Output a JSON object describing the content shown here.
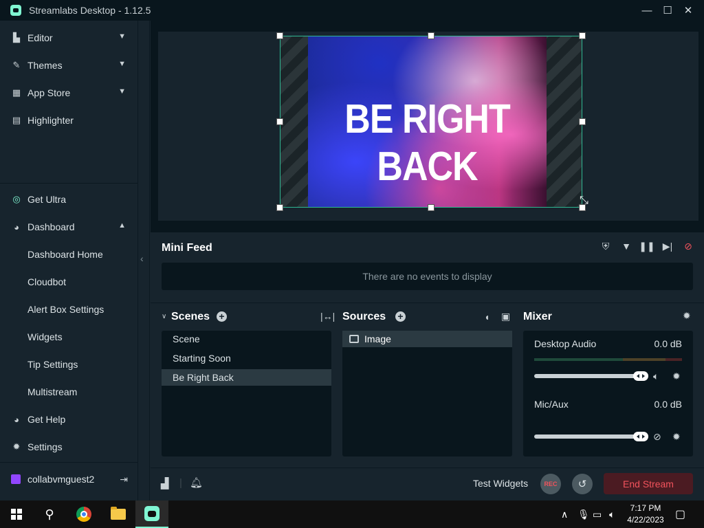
{
  "window": {
    "title": "Streamlabs Desktop - 1.12.5",
    "minimize_icon": "minimize-icon",
    "maximize_icon": "maximize-icon",
    "close_icon": "close-icon"
  },
  "sidebar": {
    "top_items": [
      {
        "label": "Editor",
        "icon": "editor-icon",
        "expandable": true
      },
      {
        "label": "Themes",
        "icon": "themes-icon",
        "expandable": true
      },
      {
        "label": "App Store",
        "icon": "store-icon",
        "expandable": true
      },
      {
        "label": "Highlighter",
        "icon": "clapper-icon",
        "expandable": false
      }
    ],
    "get_ultra": "Get Ultra",
    "dashboard": {
      "label": "Dashboard",
      "expanded": true,
      "sub_items": [
        "Dashboard Home",
        "Cloudbot",
        "Alert Box Settings",
        "Widgets",
        "Tip Settings",
        "Multistream"
      ]
    },
    "get_help": "Get Help",
    "settings": "Settings",
    "user": {
      "name": "collabvmguest2",
      "platform": "twitch"
    }
  },
  "preview": {
    "source_text": "BE RIGHT BACK"
  },
  "mini_feed": {
    "title": "Mini Feed",
    "empty_message": "There are no events to display",
    "icons": [
      "shield-icon",
      "filter-icon",
      "pause-icon",
      "skip-icon",
      "mute-alerts-icon"
    ]
  },
  "scenes": {
    "title": "Scenes",
    "items": [
      "Scene",
      "Starting Soon",
      "Be Right Back"
    ],
    "active_index": 2
  },
  "sources": {
    "title": "Sources",
    "items": [
      {
        "name": "Image",
        "icon": "image-icon"
      }
    ]
  },
  "mixer": {
    "title": "Mixer",
    "channels": [
      {
        "name": "Desktop Audio",
        "level": "0.0 dB",
        "volume_fraction": 1.0,
        "muted": false
      },
      {
        "name": "Mic/Aux",
        "level": "0.0 dB",
        "volume_fraction": 1.0,
        "muted": true
      }
    ]
  },
  "footer": {
    "test_widgets": "Test Widgets",
    "rec_label": "REC",
    "end_stream": "End Stream"
  },
  "taskbar": {
    "time": "7:17 PM",
    "date": "4/22/2023"
  },
  "colors": {
    "accent": "#80f5d2",
    "end_stream_text": "#f2535c",
    "background": "#17242d",
    "dark_panel": "#09161d"
  }
}
